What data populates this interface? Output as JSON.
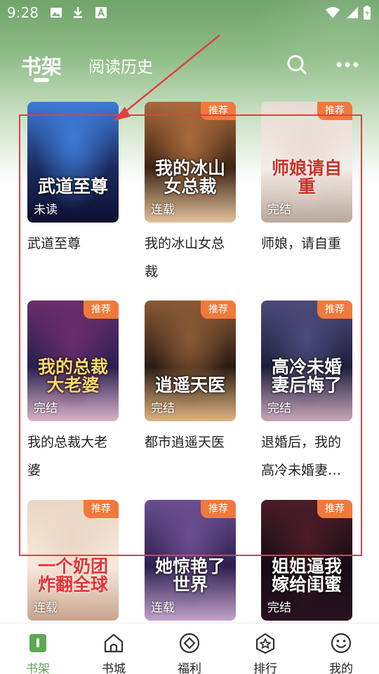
{
  "status_bar": {
    "time": "9:28",
    "left_icons": [
      "image-icon",
      "download-icon",
      "font-icon"
    ],
    "right_icons": [
      "wifi-icon",
      "signal-icon",
      "battery-icon"
    ]
  },
  "header": {
    "tabs": [
      {
        "label": "书架",
        "active": true
      },
      {
        "label": "阅读历史",
        "active": false
      }
    ],
    "actions": [
      "search-icon",
      "more-icon"
    ],
    "bg_color": "#7fb077"
  },
  "books": [
    {
      "title": "武道至尊",
      "cover_text": "武道至尊",
      "status": "未读",
      "badge": "",
      "bg": [
        "#1b2a5e",
        "#3d7bd6",
        "#0d1030"
      ]
    },
    {
      "title": "我的冰山女总裁",
      "cover_text": "我的冰山女总裁",
      "status": "连载",
      "badge": "推荐",
      "bg": [
        "#3d2416",
        "#a96a3a",
        "#e2c29a"
      ]
    },
    {
      "title": "师娘，请自重",
      "cover_text": "师娘请自重",
      "status": "完结",
      "badge": "推荐",
      "bg": [
        "#f3ece6",
        "#e9dcd4",
        "#b9a89c"
      ]
    },
    {
      "title": "我的总裁大老婆",
      "cover_text": "我的总裁大老婆",
      "status": "完结",
      "badge": "推荐",
      "bg": [
        "#2a2050",
        "#6a2d6b",
        "#d9b2c8"
      ]
    },
    {
      "title": "都市逍遥天医",
      "cover_text": "逍遥天医",
      "status": "完结",
      "badge": "推荐",
      "bg": [
        "#2a1c14",
        "#8a5a36",
        "#e0b480"
      ]
    },
    {
      "title": "退婚后，我的高冷未婚妻后悔了",
      "cover_text": "高冷未婚妻后悔了",
      "status": "完结",
      "badge": "推荐",
      "bg": [
        "#1e1f3d",
        "#4b4a7a",
        "#caa7b8"
      ]
    },
    {
      "title": "",
      "cover_text": "一个奶团炸翻全球",
      "status": "连载",
      "badge": "推荐",
      "bg": [
        "#f7e9dd",
        "#ead6c4",
        "#c9a38c"
      ]
    },
    {
      "title": "",
      "cover_text": "她惊艳了世界",
      "status": "连载",
      "badge": "推荐",
      "bg": [
        "#2c2050",
        "#6b4e8f",
        "#c3a2c9"
      ]
    },
    {
      "title": "",
      "cover_text": "姐姐逼我嫁给闺蜜",
      "status": "完结",
      "badge": "推荐",
      "bg": [
        "#140c14",
        "#4a1c26",
        "#2a1220"
      ]
    }
  ],
  "bottom_nav": [
    {
      "label": "书架",
      "icon": "bookshelf-icon",
      "active": true
    },
    {
      "label": "书城",
      "icon": "bookstore-icon",
      "active": false
    },
    {
      "label": "福利",
      "icon": "welfare-icon",
      "active": false
    },
    {
      "label": "排行",
      "icon": "ranking-icon",
      "active": false
    },
    {
      "label": "我的",
      "icon": "profile-icon",
      "active": false
    }
  ],
  "colors": {
    "accent": "#5da853",
    "badge": "#f0793c",
    "annotation": "#e04040"
  }
}
